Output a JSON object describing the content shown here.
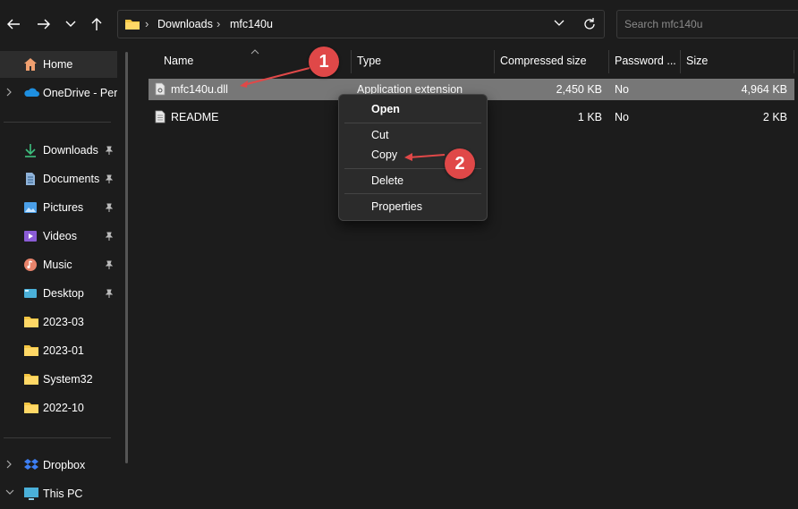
{
  "addressbar": {
    "crumbs": [
      "Downloads",
      "mfc140u"
    ]
  },
  "search": {
    "placeholder": "Search mfc140u"
  },
  "sidebar": {
    "items": [
      {
        "label": "Home",
        "icon": "home-icon"
      },
      {
        "label": "OneDrive - Perso",
        "icon": "onedrive-cloud-icon"
      },
      {
        "label": "Downloads",
        "icon": "download-arrow-icon"
      },
      {
        "label": "Documents",
        "icon": "document-icon"
      },
      {
        "label": "Pictures",
        "icon": "pictures-icon"
      },
      {
        "label": "Videos",
        "icon": "videos-icon"
      },
      {
        "label": "Music",
        "icon": "music-icon"
      },
      {
        "label": "Desktop",
        "icon": "desktop-icon"
      },
      {
        "label": "2023-03",
        "icon": "folder-icon"
      },
      {
        "label": "2023-01",
        "icon": "folder-icon"
      },
      {
        "label": "System32",
        "icon": "folder-icon"
      },
      {
        "label": "2022-10",
        "icon": "folder-icon"
      },
      {
        "label": "Dropbox",
        "icon": "dropbox-icon"
      },
      {
        "label": "This PC",
        "icon": "pc-monitor-icon"
      }
    ]
  },
  "columns": [
    "Name",
    "Type",
    "Compressed size",
    "Password ...",
    "Size"
  ],
  "files": [
    {
      "name": "mfc140u.dll",
      "type": "Application extension",
      "compressed": "2,450 KB",
      "password": "No",
      "size": "4,964 KB"
    },
    {
      "name": "README",
      "type": "",
      "compressed": "1 KB",
      "password": "No",
      "size": "2 KB"
    }
  ],
  "context_menu": {
    "open": "Open",
    "cut": "Cut",
    "copy": "Copy",
    "delete": "Delete",
    "properties": "Properties"
  },
  "annotations": {
    "step1": "1",
    "step2": "2"
  },
  "colors": {
    "accent_red": "#e04848",
    "selected_row": "#777777",
    "folder_yellow": "#f4c542"
  }
}
